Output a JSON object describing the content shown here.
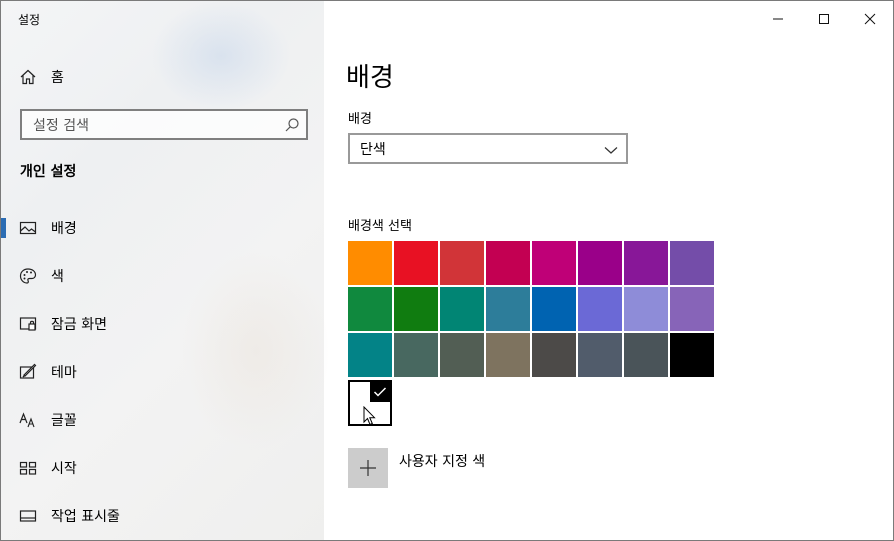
{
  "window": {
    "title": "설정"
  },
  "sidebar": {
    "home": {
      "label": "홈",
      "icon": "home-icon"
    },
    "search": {
      "placeholder": "설정 검색",
      "icon": "search-icon"
    },
    "section_title": "개인 설정",
    "items": [
      {
        "label": "배경",
        "icon": "picture-icon",
        "active": true
      },
      {
        "label": "색",
        "icon": "palette-icon",
        "active": false
      },
      {
        "label": "잠금 화면",
        "icon": "lock-screen-icon",
        "active": false
      },
      {
        "label": "테마",
        "icon": "brush-icon",
        "active": false
      },
      {
        "label": "글꼴",
        "icon": "font-icon",
        "active": false
      },
      {
        "label": "시작",
        "icon": "start-grid-icon",
        "active": false
      },
      {
        "label": "작업 표시줄",
        "icon": "taskbar-icon",
        "active": false
      }
    ]
  },
  "main": {
    "title": "배경",
    "background_label": "배경",
    "background_value": "단색",
    "color_label": "배경색 선택",
    "swatches": [
      [
        "#ff8c00",
        "#e81123",
        "#d13438",
        "#c30052",
        "#bf0077",
        "#9a0089",
        "#881798",
        "#744da9"
      ],
      [
        "#10893e",
        "#107c10",
        "#018574",
        "#2d7d9a",
        "#0063b1",
        "#6b69d6",
        "#8e8cd8",
        "#8764b8"
      ],
      [
        "#038387",
        "#486860",
        "#525e54",
        "#7e735f",
        "#4c4a48",
        "#515c6b",
        "#4a5459",
        "#000000"
      ]
    ],
    "selected_color": "#ffffff",
    "custom_color_label": "사용자 지정 색"
  },
  "colors": {
    "accent": "#2b6cb3",
    "sidebar_bg": "#f2f2f2"
  }
}
